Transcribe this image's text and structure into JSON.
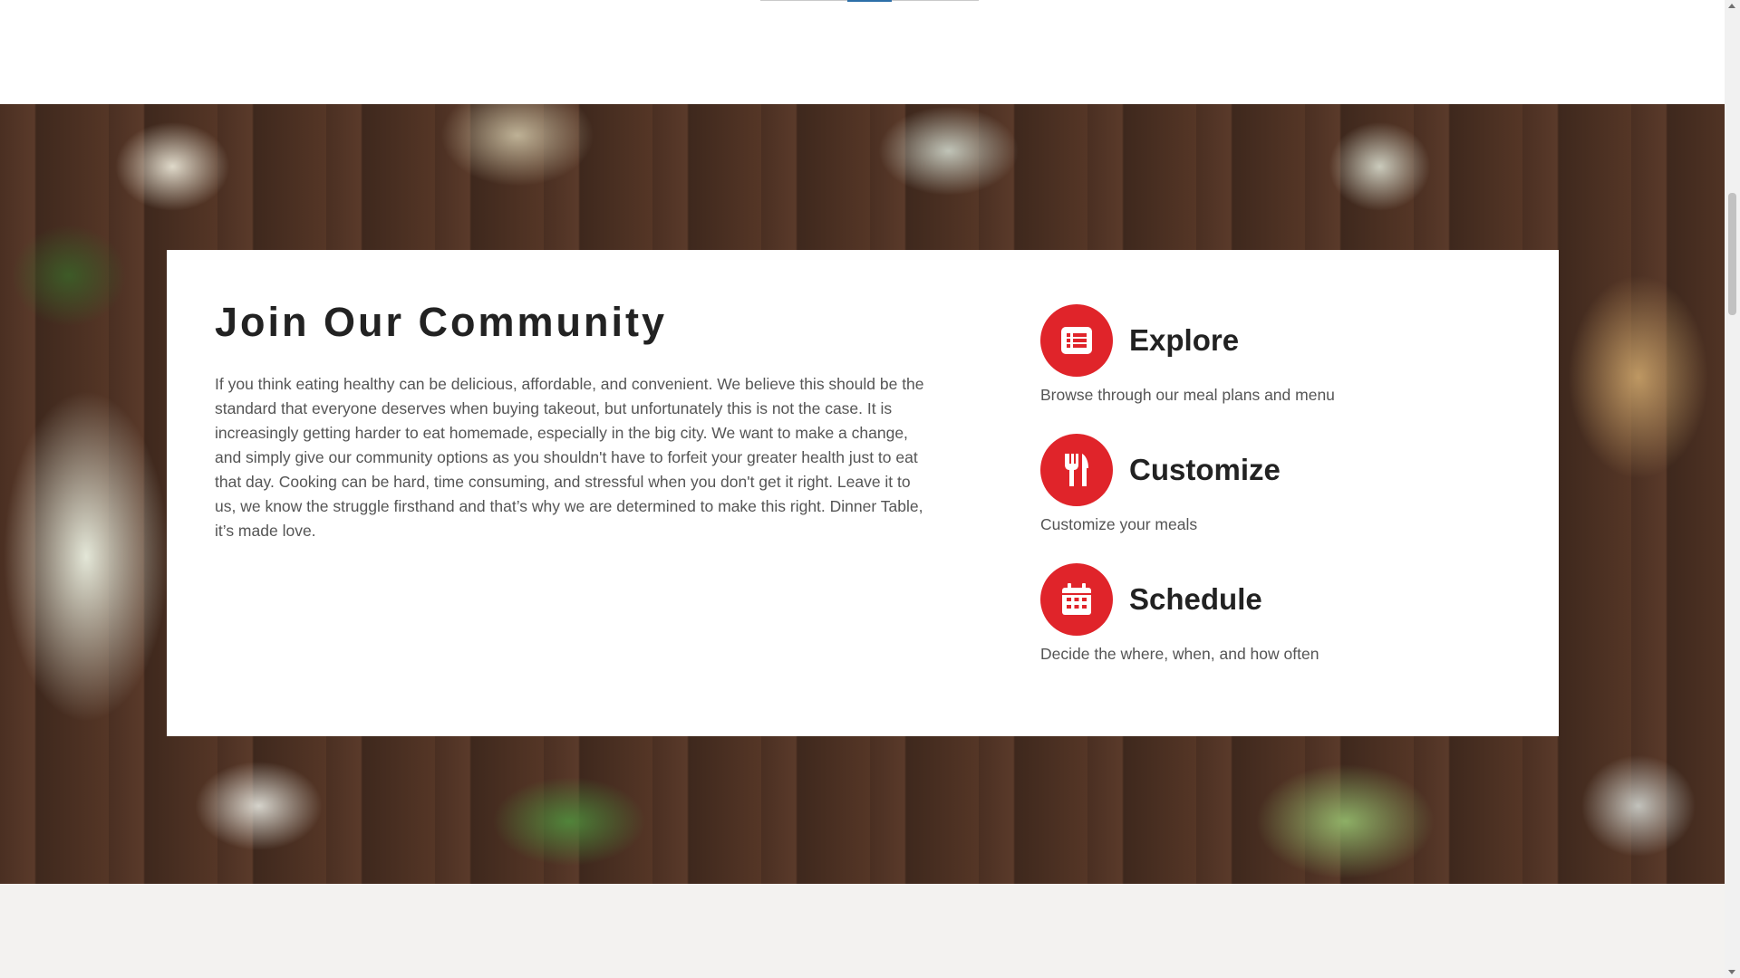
{
  "community": {
    "title": "Join Our Community",
    "body": "If you think eating healthy can be delicious, affordable, and convenient. We believe this should be the standard that everyone deserves when buying takeout, but unfortunately this is not the case. It is increasingly getting harder to eat homemade, especially in the big city. We want to make a change, and simply give our community options as you shouldn't have to forfeit your greater health just to eat that day. Cooking can be hard, time consuming, and stressful when you don't get it right. Leave it to us, we know the struggle firsthand and that’s why we are determined to make this right. Dinner Table, it’s made love."
  },
  "features": [
    {
      "icon": "list-icon",
      "title": "Explore",
      "desc": "Browse through our meal plans and menu"
    },
    {
      "icon": "utensils-icon",
      "title": "Customize",
      "desc": "Customize your meals"
    },
    {
      "icon": "calendar-icon",
      "title": "Schedule",
      "desc": "Decide the where, when, and how often"
    }
  ],
  "colors": {
    "accent": "#e0242a",
    "heading": "#222222",
    "body_text": "#555555",
    "footer_bg": "#f3f2f0"
  }
}
